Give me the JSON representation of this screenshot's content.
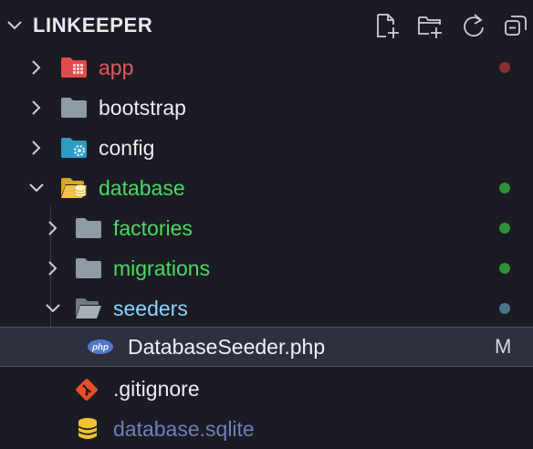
{
  "explorer": {
    "title": "LINKEEPER",
    "actions": [
      "new-file-icon",
      "new-folder-icon",
      "refresh-icon",
      "collapse-all-icon"
    ]
  },
  "tree": [
    {
      "label": "app",
      "kind": "folder",
      "icon": "laravel-folder-icon",
      "expanded": false,
      "label_color": "#e25a5a",
      "status_color": "#8a2e38",
      "status_mark": ""
    },
    {
      "label": "bootstrap",
      "kind": "folder",
      "icon": "folder-icon",
      "expanded": false,
      "label_color": "#ececf2",
      "status_color": "",
      "status_mark": ""
    },
    {
      "label": "config",
      "kind": "folder",
      "icon": "config-folder-icon",
      "expanded": false,
      "label_color": "#ececf2",
      "status_color": "",
      "status_mark": ""
    },
    {
      "label": "database",
      "kind": "folder",
      "icon": "database-folder-open-icon",
      "expanded": true,
      "label_color": "#4cd964",
      "status_color": "#2f8f3a",
      "status_mark": ""
    },
    {
      "label": "factories",
      "kind": "folder",
      "icon": "folder-icon",
      "expanded": false,
      "label_color": "#4cd964",
      "status_color": "#2f8f3a",
      "status_mark": ""
    },
    {
      "label": "migrations",
      "kind": "folder",
      "icon": "folder-icon",
      "expanded": false,
      "label_color": "#4cd964",
      "status_color": "#2f8f3a",
      "status_mark": ""
    },
    {
      "label": "seeders",
      "kind": "folder",
      "icon": "folder-open-icon",
      "expanded": true,
      "label_color": "#8fd3ff",
      "status_color": "#4e7389",
      "status_mark": ""
    },
    {
      "label": "DatabaseSeeder.php",
      "kind": "file",
      "icon": "php-icon",
      "label_color": "#f0f0f4",
      "status_color": "",
      "status_mark": "M",
      "selected": true
    },
    {
      "label": ".gitignore",
      "kind": "file",
      "icon": "git-icon",
      "label_color": "#ececf2",
      "status_color": "",
      "status_mark": ""
    },
    {
      "label": "database.sqlite",
      "kind": "file",
      "icon": "sqlite-icon",
      "label_color": "#6f7fbf",
      "status_color": "",
      "status_mark": ""
    }
  ]
}
